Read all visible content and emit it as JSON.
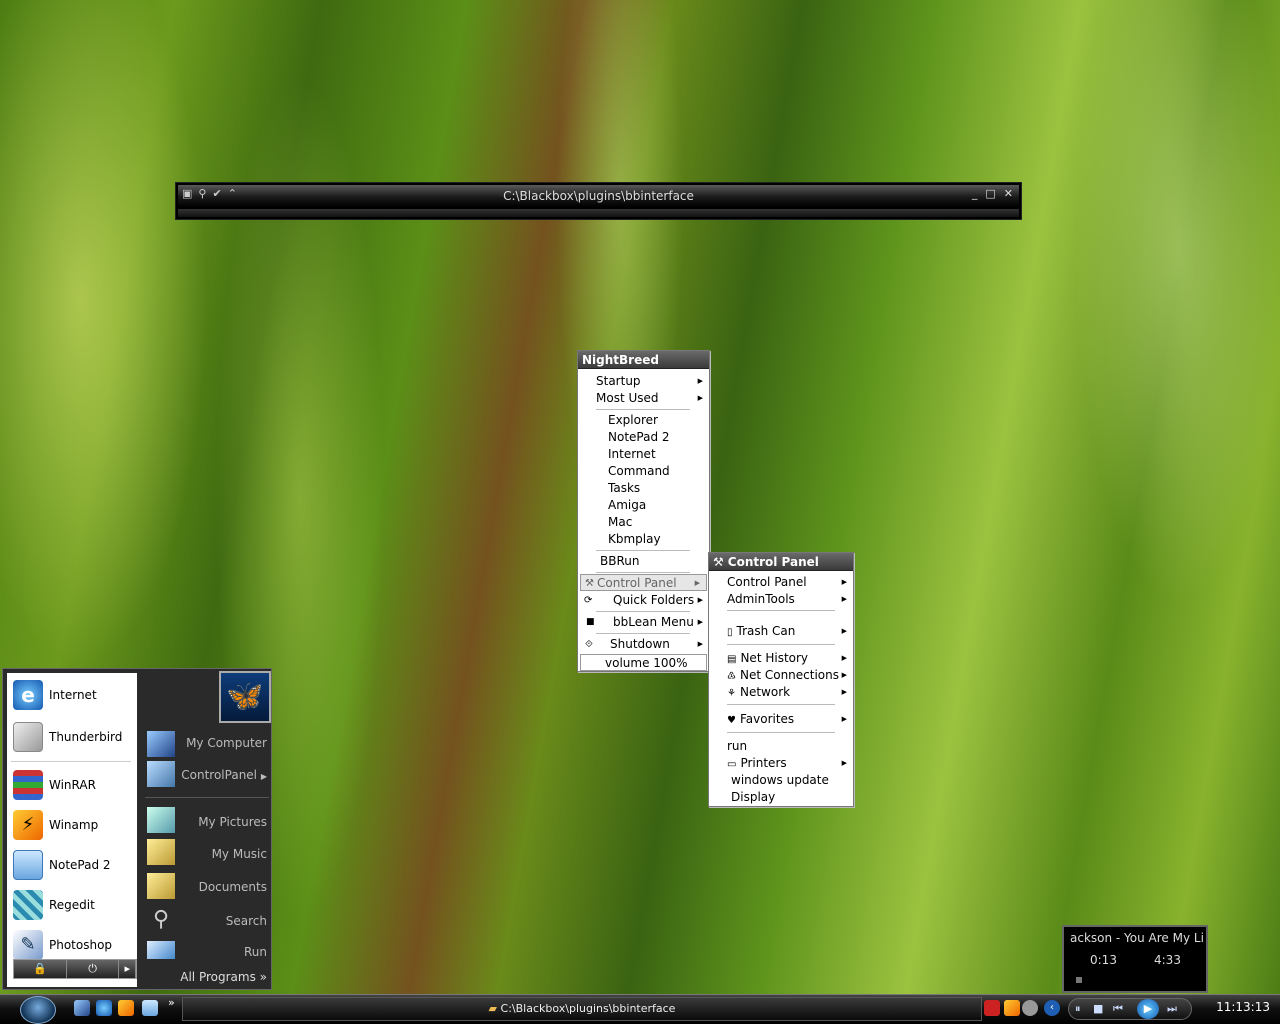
{
  "explorer_bar": {
    "path": "C:\\Blackbox\\plugins\\bbinterface",
    "left_icons": [
      "▣",
      "⚲",
      "✔",
      "⌃"
    ],
    "right_icons": [
      "_",
      "□",
      "✕"
    ]
  },
  "nightbreed_menu": {
    "title": "NightBreed",
    "items": [
      "Startup",
      "Most Used",
      "Explorer",
      "NotePad 2",
      "Internet",
      "Command",
      "Tasks",
      "Amiga",
      "Mac",
      "Kbmplay",
      "BBRun",
      "Control Panel",
      "Quick Folders",
      "bbLean Menu",
      "Shutdown",
      "volume 100%"
    ]
  },
  "control_panel_menu": {
    "title": "Control Panel",
    "items": [
      "Control Panel",
      "AdminTools",
      "Trash Can",
      "Net History",
      "Net Connections",
      "Network",
      "Favorites",
      "run",
      "Printers",
      "windows update",
      "Display"
    ]
  },
  "start_menu": {
    "left_items": [
      "Internet",
      "Thunderbird",
      "WinRAR",
      "Winamp",
      "NotePad 2",
      "Regedit",
      "Photoshop"
    ],
    "right_items": [
      "My Computer",
      "ControlPanel",
      "My Pictures",
      "My Music",
      "Documents",
      "Search",
      "Run"
    ],
    "all_programs": "All Programs"
  },
  "media_player": {
    "track": "ackson - You Are My Li",
    "elapsed": "0:13",
    "total": "4:33"
  },
  "taskbar": {
    "window_button": "C:\\Blackbox\\plugins\\bbinterface",
    "time": "11:13:13",
    "more": "»"
  },
  "colors": {
    "taskbar": "#111111",
    "menu_header": "#4a4a4a",
    "accent": "#1e5fb3"
  }
}
